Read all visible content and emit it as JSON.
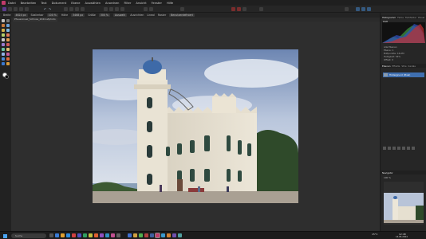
{
  "menubar": {
    "items": [
      "Datei",
      "Bearbeiten",
      "Text",
      "Dokument",
      "Ebene",
      "Auswählen",
      "Anordnen",
      "Filter",
      "Ansicht",
      "Fenster",
      "Hilfe"
    ]
  },
  "context_bar": {
    "items": [
      "Breite",
      "4624 px",
      "Skalierbar",
      "100 %",
      "Höhe",
      "3468 px",
      "Größe",
      "300 %"
    ],
    "modes": [
      "Auswahl",
      "Ausrichten",
      "Lineal",
      "Raster",
      "Benutzerdefiniert"
    ]
  },
  "document_tab": "Pfaueninsel_Schloss_2024.afphoto",
  "right_panel": {
    "top_tabs": [
      "Histogramm",
      "Farbe",
      "Farbfelder",
      "Pinsel"
    ],
    "histogram_channel": "RGB",
    "info_lines": [
      "Alle Ebenen",
      "Ebene: 1",
      "Bildpunkte: 16.0M",
      "Helligkeit: 54%",
      "Offset: 0"
    ],
    "layer_tabs": [
      "Ebenen",
      "Effekte",
      "Stile",
      "Kanäle"
    ],
    "layer_name": "Hintergrund (Pixel)",
    "navigator_tab": "Navigator",
    "zoom": "100 %"
  },
  "taskbar": {
    "search_placeholder": "Suche",
    "weather": "15°C",
    "time": "12:48",
    "date": "14.05.2024"
  },
  "colors": {
    "accent": "#3f6fb0",
    "app_bg": "#2b2b2b",
    "panel_bg": "#262626"
  }
}
